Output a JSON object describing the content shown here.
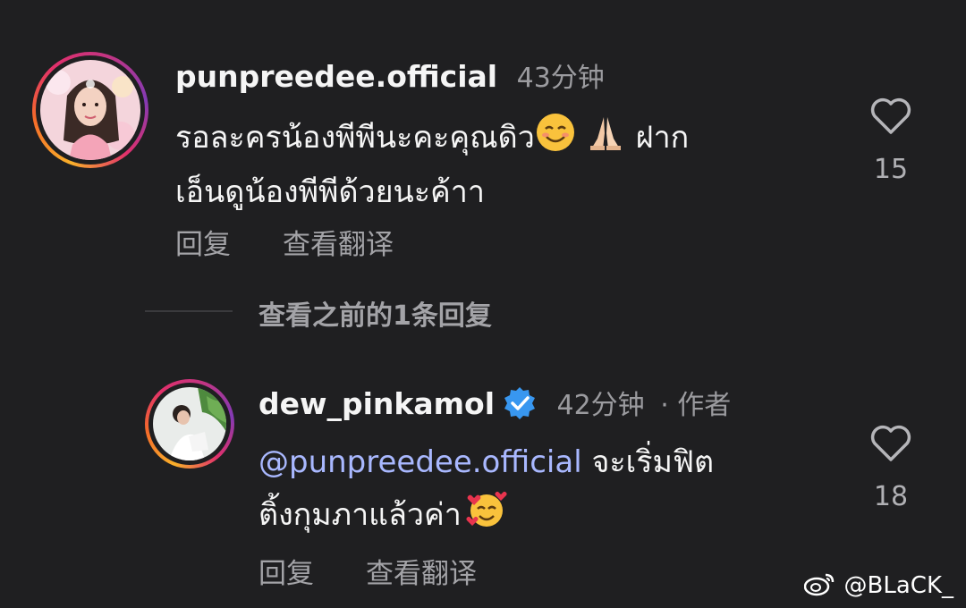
{
  "comments": [
    {
      "username": "punpreedee.official",
      "time": "43分钟",
      "text_line1": "รอละครน้องพีพีนะคะคุณดิว",
      "text_line1_after": " ฝาก",
      "text_line2": "เอ็นดูน้องพีพีด้วยนะค้าา",
      "reply_label": "回复",
      "translate_label": "查看翻译",
      "likes": "15"
    },
    {
      "username": "dew_pinkamol",
      "time": "42分钟",
      "author_tag": "· 作者",
      "mention": "@punpreedee.official",
      "text_line1": " จะเริ่มฟิต",
      "text_line2": "ติ้งกุมภาแล้วค่า",
      "reply_label": "回复",
      "translate_label": "查看翻译",
      "likes": "18"
    }
  ],
  "view_previous": "查看之前的1条回复",
  "watermark": "@BLaCK_",
  "colors": {
    "background": "#1f1f21",
    "mention": "#a9b8ff",
    "verified": "#3897f0",
    "muted": "#a3a3a7"
  }
}
